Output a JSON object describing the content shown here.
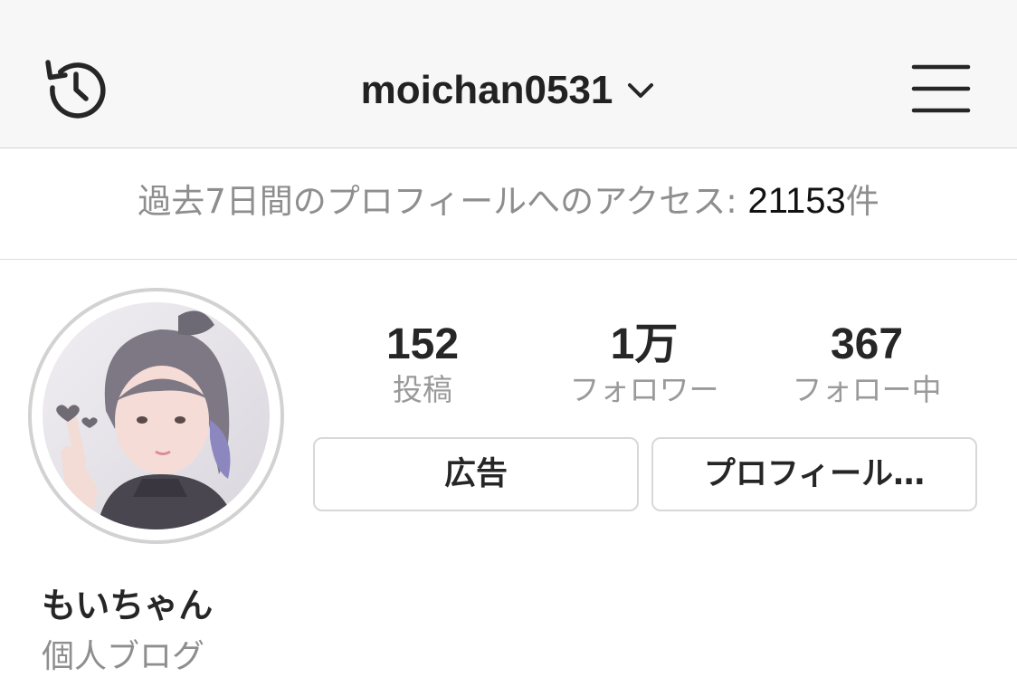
{
  "header": {
    "username": "moichan0531"
  },
  "insights": {
    "label": "過去7日間のプロフィールへのアクセス: ",
    "count": "21153",
    "suffix": "件"
  },
  "stats": {
    "posts": {
      "value": "152",
      "label": "投稿"
    },
    "followers": {
      "value": "1万",
      "label": "フォロワー"
    },
    "following": {
      "value": "367",
      "label": "フォロー中"
    }
  },
  "buttons": {
    "ads": "広告",
    "profile": "プロフィール…"
  },
  "profile": {
    "name": "もいちゃん",
    "category": "個人ブログ"
  },
  "icons": {
    "history": "history-clock-icon",
    "chevron": "chevron-down-icon",
    "menu": "hamburger-menu-icon"
  },
  "colors": {
    "topbar_bg": "#f7f7f7",
    "muted_text": "#8e8e8e",
    "border": "#d8d8d8"
  }
}
